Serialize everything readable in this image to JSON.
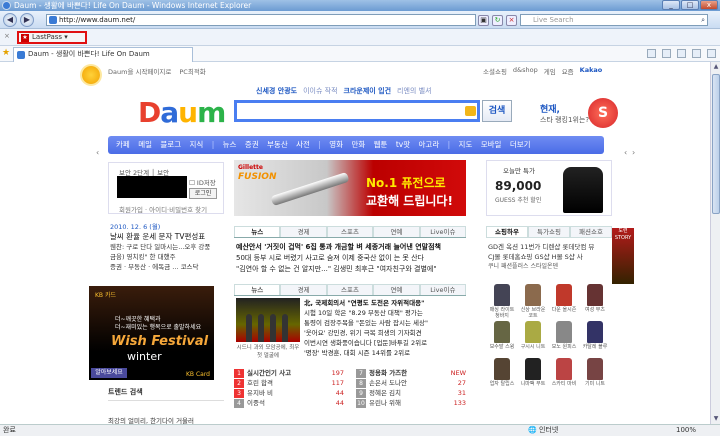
{
  "window": {
    "title": "Daum - 생활에 바쁜다! Life On Daum - Windows Internet Explorer",
    "btn_min": "_",
    "btn_max": "□",
    "btn_close": "x"
  },
  "browser": {
    "back": "◀",
    "fwd": "▶",
    "url": "http://www.daum.net/",
    "search_placeholder": "Live Search",
    "search_icon": "search-icon",
    "tab_title": "Daum - 생활이 바쁜다! Life On Daum",
    "lastpass": "LastPass",
    "lastpass_icon": "★",
    "status": "완료",
    "zone": "인터넷",
    "zoom": "100%"
  },
  "page": {
    "top_links": [
      "Daum을 시작페이지로",
      "PC최적화"
    ],
    "right_links": [
      "소셜쇼핑",
      "d&shop",
      "게임",
      "요즘",
      "Kakao"
    ],
    "logo": [
      "D",
      "a",
      "u",
      "m"
    ],
    "logo_colors": [
      "#e8402e",
      "#2f6bd8",
      "#ffb400",
      "#2cb34a"
    ],
    "trending": [
      "신세경 안광도",
      "이이슈 작적",
      "크라운제이 입건",
      "리엔의 벨셔"
    ],
    "search_button": "검색",
    "promo_title": "현재,",
    "promo_sub": "스타 랭킹1위는?",
    "promo_s": "S",
    "gnb": [
      "카페",
      "메일",
      "블로그",
      "지식",
      "뉴스",
      "증권",
      "부동산",
      "사전",
      "영화",
      "만화",
      "웹툰",
      "tv팟",
      "아고라",
      "지도",
      "모바일",
      "더보기"
    ],
    "pager_l": "‹",
    "pager_r": "›",
    "login": {
      "line1": "보안 2단계  │ 보안",
      "id_save": "ID저장",
      "button": "로그인",
      "line2": "회원가입 · 아이디·비밀번호 찾기"
    },
    "news_left": {
      "date": "2010. 12. 6 (월)",
      "menu": "날씨 환율 운세 문자 TV편성표",
      "lines": [
        "웬찬: 구로 단다 일마시는...오후 강풍",
        "금융) 영치킹\" 한 대했주",
        "증권 · 부동산 · 에독금 ... 코스닥"
      ]
    },
    "banner_left": {
      "kb": "KB 카드",
      "t1": "더~깨끗한 혜택과",
      "t2": "더~재미있는 행복으로 출발하세요",
      "fest": "Wish Festival",
      "winter": "winter",
      "more": "알아보세요",
      "kbcard": "KB Card"
    },
    "trend_box": {
      "title": "트렌드 검색",
      "body": "최강의 얼미리, 한기다이 거울러"
    },
    "ad": {
      "brand": "Gillette",
      "product": "FUSION",
      "copy1": "No.1 퓨전으로",
      "copy2": "교환해 드립니다!"
    },
    "news_tabs": [
      "뉴스",
      "경제",
      "스포츠",
      "연예",
      "Live이슈"
    ],
    "headlines": [
      "예산안서 '거짓이 겁먹' 6집 통과 개금할 벼   세종거래 늘어낸 연말점책",
      "50대 등부 시로 버렸기 사고로 숨져   이제 중국산 없이 는 못 산다",
      "\"김연아 할 수 없는 건 알지만...\"   김생민 최후근 \"여자친구와 결별에\""
    ],
    "tabs2": [
      "뉴스",
      "경제",
      "스포츠",
      "연예",
      "Live이슈"
    ],
    "photo_cap": "시드니 과외 모암공에, 최우 첫 얼굴에",
    "news2": {
      "h": "北, 국제회의서 \"연평도 도전은 자위적대응\"",
      "lines": [
        "시험 10일 학은 \"8.29 부동산 대책\" 평가는",
        "통령이 검장주목을 \"돈있는 사람 잡시는 세상\"",
        "'웃어요' 강민경, 위기 극복 희생의 기자회견",
        "이번시연 생화풍이습니다   [업둔]바투길 2위로",
        "'명장' 박경훈, 대회 시즌 14위를 2위로"
      ]
    },
    "rank_left": [
      [
        "실시간인기 사고",
        ""
      ],
      [
        "호린 합격",
        "117"
      ],
      [
        "유지바 비",
        "44"
      ],
      [
        "이중석",
        "44"
      ]
    ],
    "rank_right": [
      [
        "정용화 가즈한",
        ""
      ],
      [
        "손은서 도나안",
        "27"
      ],
      [
        "정혜은 김치",
        "31"
      ],
      [
        "유린나 위해",
        "133"
      ]
    ],
    "shop": {
      "title": "오늘만 특가",
      "price": "89,000",
      "brand": "GUESS 추천 할인"
    },
    "shop_tabs": [
      "쇼핑하우",
      "특가쇼핑",
      "패션쇼호"
    ],
    "shop_list": [
      "GD겐 옥션 11번가 디렌샵 롯데닷컴 뷰",
      "CJ몰 롯데홈쇼핑 GS샵 H몰 S샵 사"
    ],
    "shop_sub": "쿠니 패션플러스 스타일온덴",
    "grid_items": [
      [
        "매싱 라이트 청바지",
        "#445"
      ],
      [
        "신상 브라운코트",
        "#8b6a4d"
      ],
      [
        "다운 올시즌",
        "#c0392b"
      ],
      [
        "여성 부츠",
        "#633"
      ],
      [
        "보수발 스윙",
        "#664"
      ],
      [
        "구시시 니트",
        "#aa4"
      ],
      [
        "모노 원피스",
        "#888"
      ],
      [
        "카탈레 블루",
        "#336"
      ],
      [
        "업자 탈립스",
        "#543"
      ],
      [
        "니마팩 무트",
        "#222"
      ],
      [
        "스카티 마비",
        "#b44"
      ],
      [
        "기미 니트",
        "#744"
      ]
    ],
    "side_ban": "도련 STORY"
  }
}
